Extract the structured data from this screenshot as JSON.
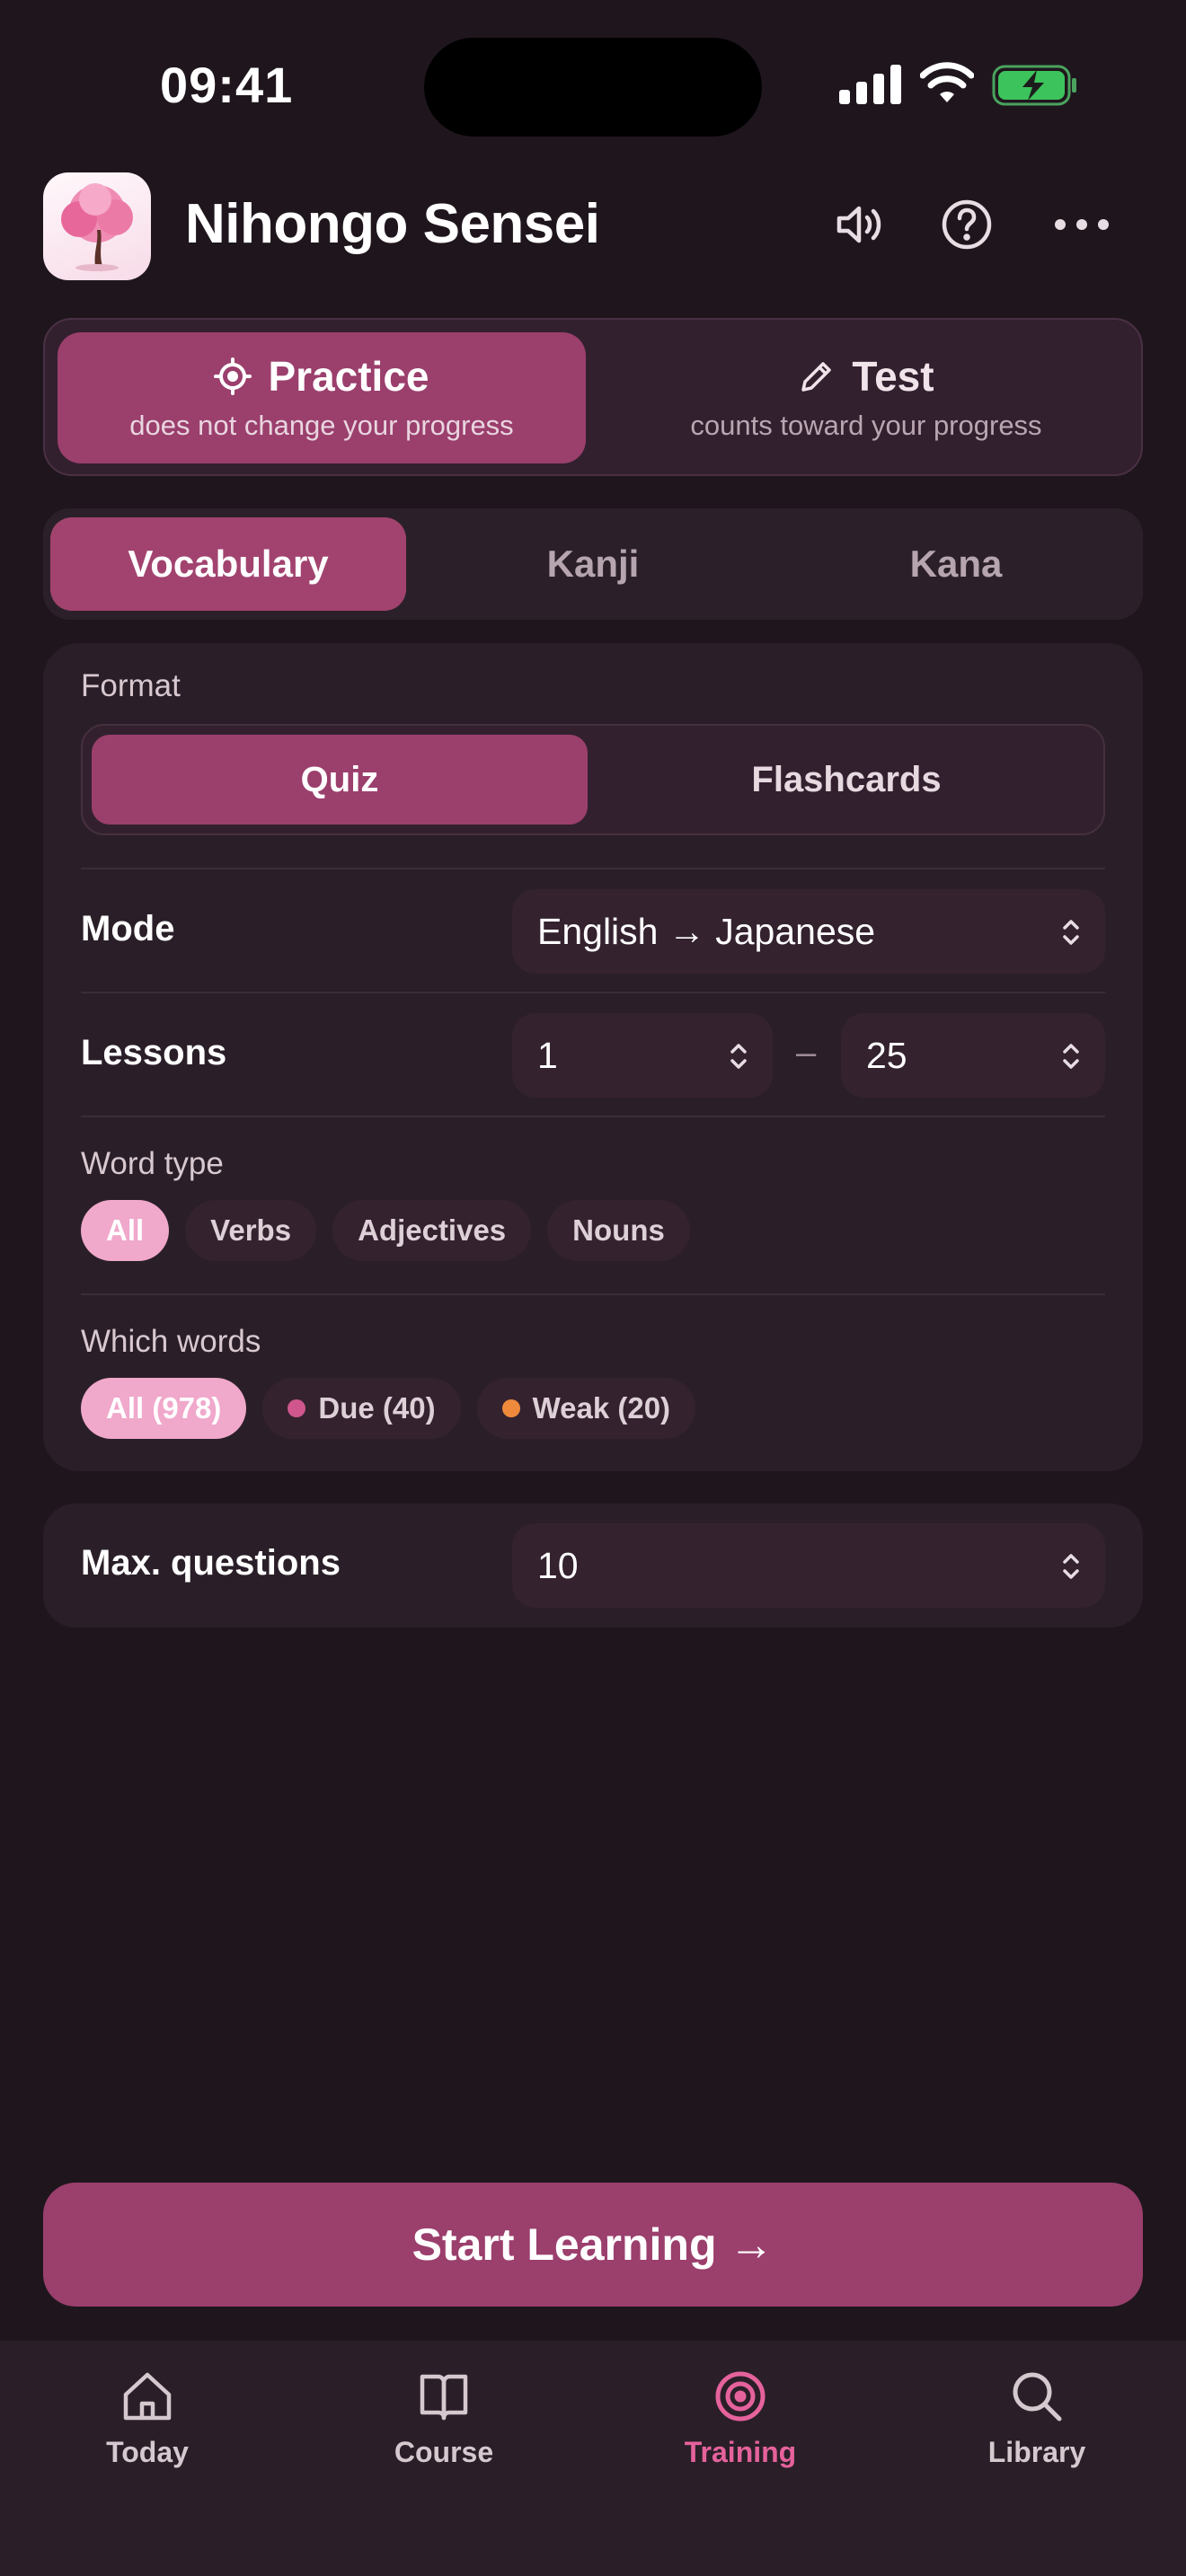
{
  "status_bar": {
    "time": "09:41"
  },
  "header": {
    "app_title": "Nihongo Sensei",
    "icons": [
      "sakura-app-icon",
      "speaker-icon",
      "help-icon",
      "more-icon"
    ]
  },
  "mode_toggle": {
    "options": [
      {
        "title": "Practice",
        "subtitle": "does not change your progress",
        "icon": "target-icon",
        "selected": true
      },
      {
        "title": "Test",
        "subtitle": "counts toward your progress",
        "icon": "pencil-icon",
        "selected": false
      }
    ]
  },
  "category_tabs": [
    {
      "label": "Vocabulary",
      "selected": true
    },
    {
      "label": "Kanji",
      "selected": false
    },
    {
      "label": "Kana",
      "selected": false
    }
  ],
  "settings": {
    "format": {
      "label": "Format",
      "options": [
        {
          "label": "Quiz",
          "selected": true
        },
        {
          "label": "Flashcards",
          "selected": false
        }
      ]
    },
    "mode": {
      "label": "Mode",
      "value": "English → Japanese"
    },
    "lessons": {
      "label": "Lessons",
      "from": "1",
      "separator": "–",
      "to": "25"
    },
    "word_type": {
      "label": "Word type",
      "chips": [
        {
          "label": "All",
          "selected": true
        },
        {
          "label": "Verbs",
          "selected": false
        },
        {
          "label": "Adjectives",
          "selected": false
        },
        {
          "label": "Nouns",
          "selected": false
        }
      ]
    },
    "which_words": {
      "label": "Which words",
      "chips": [
        {
          "label": "All (978)",
          "selected": true,
          "dot_color": null
        },
        {
          "label": "Due (40)",
          "selected": false,
          "dot_color": "#d0578e"
        },
        {
          "label": "Weak (20)",
          "selected": false,
          "dot_color": "#ef8a3c"
        }
      ]
    }
  },
  "max_questions": {
    "label": "Max. questions",
    "value": "10"
  },
  "start_button": {
    "label": "Start Learning →"
  },
  "tab_bar": [
    {
      "label": "Today",
      "icon": "home-icon",
      "selected": false
    },
    {
      "label": "Course",
      "icon": "book-icon",
      "selected": false
    },
    {
      "label": "Training",
      "icon": "target-icon",
      "selected": true
    },
    {
      "label": "Library",
      "icon": "search-icon",
      "selected": false
    }
  ],
  "colors": {
    "background": "#1f161d",
    "accent": "#9b3f6d",
    "accent_light": "#f0a8cb",
    "tab_active": "#e5629c"
  }
}
